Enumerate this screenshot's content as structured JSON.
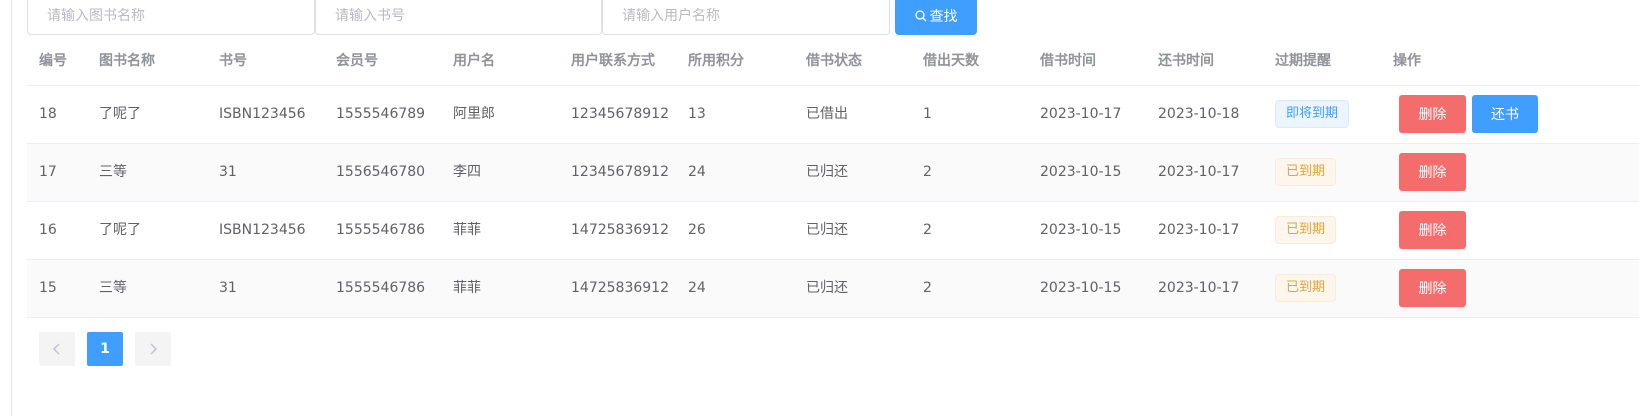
{
  "search": {
    "book_name_placeholder": "请输入图书名称",
    "isbn_placeholder": "请输入书号",
    "username_placeholder": "请输入用户名称",
    "search_label": "查找"
  },
  "table": {
    "headers": [
      "编号",
      "图书名称",
      "书号",
      "会员号",
      "用户名",
      "用户联系方式",
      "所用积分",
      "借书状态",
      "借出天数",
      "借书时间",
      "还书时间",
      "过期提醒",
      "操作"
    ],
    "rows": [
      {
        "id": "18",
        "book_name": "了呢了",
        "isbn": "ISBN123456",
        "member_no": "1555546789",
        "username": "阿里郎",
        "phone": "12345678912",
        "points": "13",
        "status": "已借出",
        "days": "1",
        "borrow_date": "2023-10-17",
        "return_date": "2023-10-18",
        "reminder": "即将到期",
        "reminder_type": "soon",
        "delete_label": "删除",
        "return_label": "还书"
      },
      {
        "id": "17",
        "book_name": "三等",
        "isbn": "31",
        "member_no": "1556546780",
        "username": "李四",
        "phone": "12345678912",
        "points": "24",
        "status": "已归还",
        "days": "2",
        "borrow_date": "2023-10-15",
        "return_date": "2023-10-17",
        "reminder": "已到期",
        "reminder_type": "expired",
        "delete_label": "删除"
      },
      {
        "id": "16",
        "book_name": "了呢了",
        "isbn": "ISBN123456",
        "member_no": "1555546786",
        "username": "菲菲",
        "phone": "14725836912",
        "points": "26",
        "status": "已归还",
        "days": "2",
        "borrow_date": "2023-10-15",
        "return_date": "2023-10-17",
        "reminder": "已到期",
        "reminder_type": "expired",
        "delete_label": "删除"
      },
      {
        "id": "15",
        "book_name": "三等",
        "isbn": "31",
        "member_no": "1555546786",
        "username": "菲菲",
        "phone": "14725836912",
        "points": "24",
        "status": "已归还",
        "days": "2",
        "borrow_date": "2023-10-15",
        "return_date": "2023-10-17",
        "reminder": "已到期",
        "reminder_type": "expired",
        "delete_label": "删除"
      }
    ]
  },
  "pagination": {
    "current_page": "1",
    "prev_icon": "chevron-left-icon",
    "next_icon": "chevron-right-icon"
  },
  "colors": {
    "primary": "#409eff",
    "danger": "#f56c6c",
    "warning": "#e6a23c"
  }
}
